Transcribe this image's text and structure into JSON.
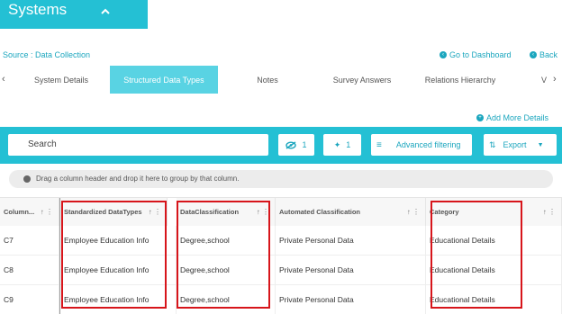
{
  "header": {
    "title": "Systems"
  },
  "source": {
    "label": "Source : Data Collection"
  },
  "links": {
    "dashboard": "Go to Dashboard",
    "back": "Back"
  },
  "tabs": [
    {
      "label": "System Details"
    },
    {
      "label": "Structured Data Types"
    },
    {
      "label": "Notes"
    },
    {
      "label": "Survey Answers"
    },
    {
      "label": "Relations Hierarchy"
    },
    {
      "label": "V"
    }
  ],
  "add_more": "Add More Details",
  "toolbar": {
    "search_label": "Search",
    "hidden_count": "1",
    "pinned_count": "1",
    "advanced_filtering": "Advanced filtering",
    "export": "Export"
  },
  "group_hint": "Drag a column header and drop it here to group by that column.",
  "table": {
    "columns": [
      "Column...",
      "Standardized DataTypes",
      "DataClassification",
      "Automated Classification",
      "Category"
    ],
    "rows": [
      [
        "C7",
        "Employee Education Info",
        "Degree,school",
        "Private Personal Data",
        "Educational Details"
      ],
      [
        "C8",
        "Employee Education Info",
        "Degree,school",
        "Private Personal Data",
        "Educational Details"
      ],
      [
        "C9",
        "Employee Education Info",
        "Degree,school",
        "Private Personal Data",
        "Educational Details"
      ]
    ]
  },
  "colors": {
    "accent": "#24c0d4",
    "tab_active": "#59d3e3",
    "highlight": "#d7151b"
  }
}
